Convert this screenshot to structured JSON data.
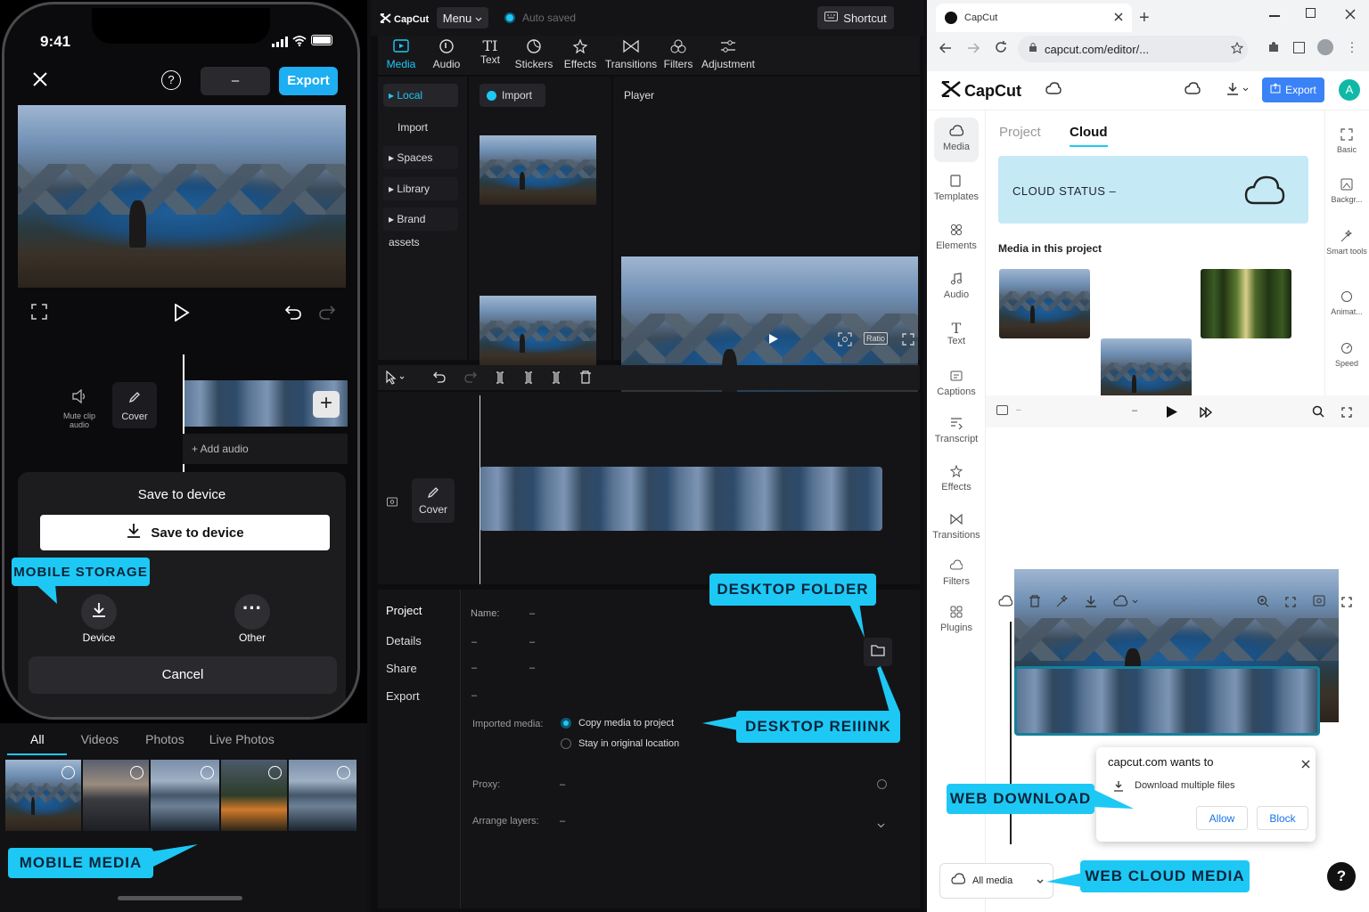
{
  "phone": {
    "time": "9:41",
    "export_label": "Export",
    "project_name": "–",
    "mute_label": "Mute clip audio",
    "cover_label": "Cover",
    "add_audio": "+ Add audio",
    "sheet_title": "Save to device",
    "save_button": "Save to device",
    "device_label": "Device",
    "other_label": "Other",
    "cancel_label": "Cancel",
    "gallery_tabs": [
      "All",
      "Videos",
      "Photos",
      "Live Photos"
    ],
    "callout_storage": "MOBILE STORAGE",
    "callout_media": "MOBILE MEDIA"
  },
  "desktop": {
    "brand": "CapCut",
    "menu_label": "Menu",
    "autosave": "Auto saved",
    "shortcut": "Shortcut",
    "toolbar": [
      "Media",
      "Audio",
      "Text",
      "Stickers",
      "Effects",
      "Transitions",
      "Filters",
      "Adjustment"
    ],
    "sidebar": [
      "Local",
      "Import",
      "Spaces",
      "Library",
      "Brand assets"
    ],
    "import_button": "Import",
    "player_label": "Player",
    "ratio_label": "Ratio",
    "cover_label": "Cover",
    "project_nav": [
      "Project",
      "Details",
      "Share",
      "Export"
    ],
    "name_label": "Name:",
    "name_value": "–",
    "detail_values": [
      "–",
      "–",
      "–",
      "–",
      "–"
    ],
    "imported_media_label": "Imported media:",
    "copy_option": "Copy media to project",
    "stay_option": "Stay in original location",
    "proxy_label": "Proxy:",
    "proxy_value": "–",
    "arrange_label": "Arrange layers:",
    "arrange_value": "–",
    "callout_folder": "DESKTOP FOLDER",
    "callout_relink": "DESKTOP REIIINK"
  },
  "web": {
    "tab_title": "CapCut",
    "url": "capcut.com/editor/...",
    "brand": "CapCut",
    "export_label": "Export",
    "avatar": "A",
    "left_nav": [
      "Media",
      "Templates",
      "Elements",
      "Audio",
      "Text",
      "Captions",
      "Transcript",
      "Effects",
      "Transitions",
      "Filters",
      "Plugins"
    ],
    "right_nav": [
      "Basic",
      "Backgr...",
      "Smart tools",
      "Animat...",
      "Speed"
    ],
    "tabs": [
      "Project",
      "Cloud"
    ],
    "cloud_status": "CLOUD STATUS –",
    "media_heading": "Media in this project",
    "timecode": "–",
    "timecode2": "–",
    "popup_title": "capcut.com wants to",
    "popup_text": "Download multiple files",
    "allow": "Allow",
    "block": "Block",
    "all_media": "All media",
    "help": "?",
    "callout_download": "WEB DOWNLOAD",
    "callout_cloud": "WEB CLOUD MEDIA"
  }
}
